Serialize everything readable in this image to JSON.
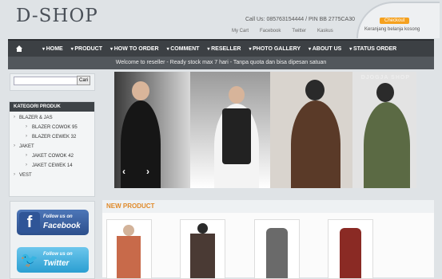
{
  "header": {
    "logo": "D-SHOP",
    "contact": "Call Us: 085763154444 / PIN BB 2775CA30",
    "links": [
      "My Cart",
      "Facebook",
      "Twitter",
      "Kaskus"
    ],
    "checkout_label": "Checkout",
    "cart_status": "Keranjang belanja kosong"
  },
  "nav": {
    "items": [
      "HOME",
      "PRODUCT",
      "HOW TO ORDER",
      "COMMENT",
      "RESELLER",
      "PHOTO GALLERY",
      "ABOUT US",
      "STATUS ORDER"
    ]
  },
  "ticker": "Welcome to reseller - Ready stock max 7 hari - Tanpa quota dan bisa dipesan satuan",
  "search": {
    "button": "Cari"
  },
  "kategori": {
    "title": "KATEGORI PRODUK",
    "items": [
      {
        "label": "BLAZER & JAS",
        "sub": false
      },
      {
        "label": "BLAZER COWOK 95",
        "sub": true
      },
      {
        "label": "BLAZER CEWEK 32",
        "sub": true
      },
      {
        "label": "JAKET",
        "sub": false
      },
      {
        "label": "JAKET COWOK 42",
        "sub": true
      },
      {
        "label": "JAKET CEWEK 14",
        "sub": true
      },
      {
        "label": "VEST",
        "sub": false
      }
    ]
  },
  "social": {
    "facebook": {
      "line1": "Follow us on",
      "line2": "Facebook"
    },
    "twitter": {
      "line1": "Follow us on",
      "line2": "Twitter"
    }
  },
  "slider": {
    "watermark": "DJOGJA SHOP"
  },
  "new_product": {
    "title": "NEW PRODUCT"
  },
  "colors": {
    "accent": "#f5a11f",
    "nav": "#3c4044",
    "new_product_title": "#e08a2a",
    "facebook": "#3b5998",
    "twitter": "#2b9fd2"
  }
}
